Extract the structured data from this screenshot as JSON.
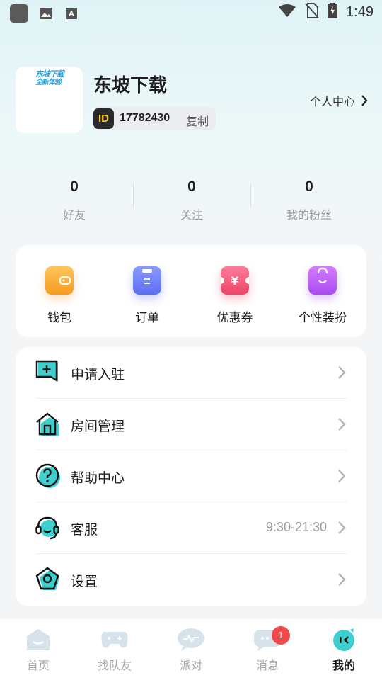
{
  "status_bar": {
    "time": "1:49",
    "icons": [
      "app-square-icon",
      "image-icon",
      "text-a-icon",
      "wifi-icon",
      "no-sim-icon",
      "battery-charging-icon"
    ]
  },
  "profile": {
    "avatar_text_line1": "东坡下载",
    "avatar_text_line2": "全新体验",
    "name": "东坡下载",
    "id_badge": "ID",
    "id": "17782430",
    "copy_label": "复制",
    "personal_center": "个人中心"
  },
  "stats": [
    {
      "value": "0",
      "label": "好友"
    },
    {
      "value": "0",
      "label": "关注"
    },
    {
      "value": "0",
      "label": "我的粉丝"
    }
  ],
  "quick_actions": [
    {
      "label": "钱包",
      "icon": "wallet-icon",
      "color": "#f5a623"
    },
    {
      "label": "订单",
      "icon": "order-icon",
      "color": "#6b7cf5"
    },
    {
      "label": "优惠券",
      "icon": "coupon-icon",
      "color": "#f2567a"
    },
    {
      "label": "个性装扮",
      "icon": "shopping-bag-icon",
      "color": "#b15ef0"
    }
  ],
  "menu": [
    {
      "label": "申请入驻",
      "icon": "apply-join-icon",
      "value": ""
    },
    {
      "label": "房间管理",
      "icon": "room-house-icon",
      "value": ""
    },
    {
      "label": "帮助中心",
      "icon": "help-question-icon",
      "value": ""
    },
    {
      "label": "客服",
      "icon": "headset-icon",
      "value": "9:30-21:30"
    },
    {
      "label": "设置",
      "icon": "settings-pentagon-icon",
      "value": ""
    }
  ],
  "tabs": [
    {
      "label": "首页",
      "icon": "home-icon"
    },
    {
      "label": "找队友",
      "icon": "gamepad-icon"
    },
    {
      "label": "派对",
      "icon": "party-bubble-icon"
    },
    {
      "label": "消息",
      "icon": "message-icon",
      "badge": "1"
    },
    {
      "label": "我的",
      "icon": "profile-face-icon",
      "active": true
    }
  ],
  "colors": {
    "accent_teal": "#3ecfcf",
    "badge_red": "#ef4a4a"
  }
}
